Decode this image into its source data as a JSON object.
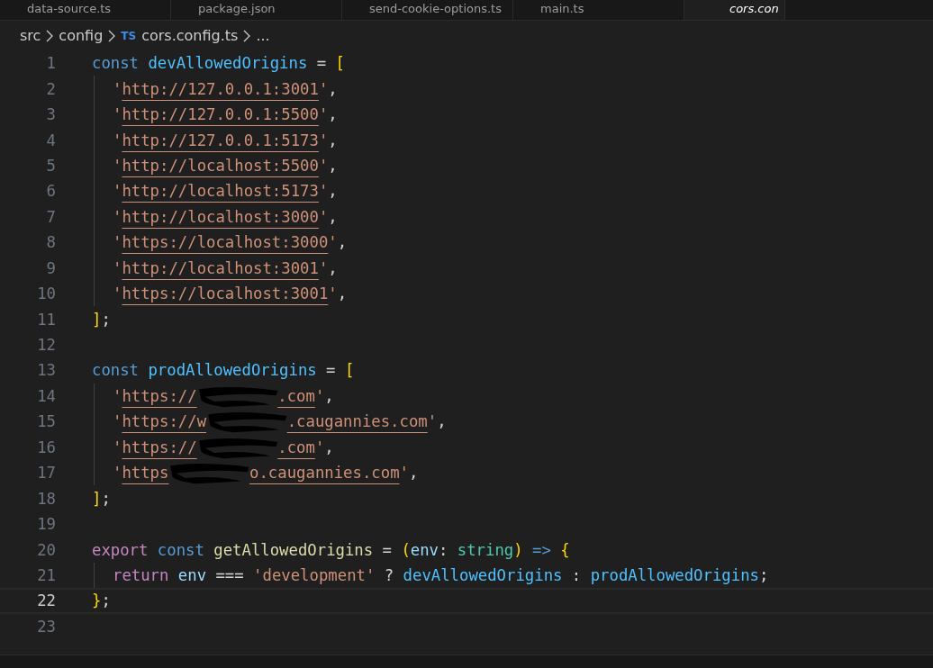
{
  "tabs": [
    {
      "label": "data-source.ts",
      "selected": false
    },
    {
      "label": "package.json",
      "selected": false
    },
    {
      "label": "send-cookie-options.ts",
      "selected": false
    },
    {
      "label": "main.ts",
      "selected": false
    },
    {
      "label": "cors.con",
      "selected": true
    }
  ],
  "breadcrumb": [
    {
      "kind": "folder",
      "label": "src"
    },
    {
      "kind": "folder",
      "label": "config"
    },
    {
      "kind": "file",
      "badge": "TS",
      "label": "cors.config.ts"
    },
    {
      "kind": "more",
      "label": "..."
    }
  ],
  "lines": [
    {
      "number": "1",
      "selected": false,
      "indented": false,
      "tokens": [
        {
          "kind": "kw",
          "text": "const "
        },
        {
          "kind": "var",
          "text": "devAllowedOrigins"
        },
        {
          "kind": "p",
          "text": " = "
        },
        {
          "kind": "br",
          "text": "["
        }
      ]
    },
    {
      "number": "2",
      "selected": false,
      "indented": true,
      "tokens": [
        {
          "kind": "str",
          "text": "'"
        },
        {
          "kind": "link",
          "text": "http://127.0.0.1:3001"
        },
        {
          "kind": "str",
          "text": "'"
        },
        {
          "kind": "p",
          "text": ","
        }
      ]
    },
    {
      "number": "3",
      "selected": false,
      "indented": true,
      "tokens": [
        {
          "kind": "str",
          "text": "'"
        },
        {
          "kind": "link",
          "text": "http://127.0.0.1:5500"
        },
        {
          "kind": "str",
          "text": "'"
        },
        {
          "kind": "p",
          "text": ","
        }
      ]
    },
    {
      "number": "4",
      "selected": false,
      "indented": true,
      "tokens": [
        {
          "kind": "str",
          "text": "'"
        },
        {
          "kind": "link",
          "text": "http://127.0.0.1:5173"
        },
        {
          "kind": "str",
          "text": "'"
        },
        {
          "kind": "p",
          "text": ","
        }
      ]
    },
    {
      "number": "5",
      "selected": false,
      "indented": true,
      "tokens": [
        {
          "kind": "str",
          "text": "'"
        },
        {
          "kind": "link",
          "text": "http://localhost:5500"
        },
        {
          "kind": "str",
          "text": "'"
        },
        {
          "kind": "p",
          "text": ","
        }
      ]
    },
    {
      "number": "6",
      "selected": false,
      "indented": true,
      "tokens": [
        {
          "kind": "str",
          "text": "'"
        },
        {
          "kind": "link",
          "text": "http://localhost:5173"
        },
        {
          "kind": "str",
          "text": "'"
        },
        {
          "kind": "p",
          "text": ","
        }
      ]
    },
    {
      "number": "7",
      "selected": false,
      "indented": true,
      "tokens": [
        {
          "kind": "str",
          "text": "'"
        },
        {
          "kind": "link",
          "text": "http://localhost:3000"
        },
        {
          "kind": "str",
          "text": "'"
        },
        {
          "kind": "p",
          "text": ","
        }
      ]
    },
    {
      "number": "8",
      "selected": false,
      "indented": true,
      "tokens": [
        {
          "kind": "str",
          "text": "'"
        },
        {
          "kind": "link",
          "text": "https://localhost:3000"
        },
        {
          "kind": "str",
          "text": "'"
        },
        {
          "kind": "p",
          "text": ","
        }
      ]
    },
    {
      "number": "9",
      "selected": false,
      "indented": true,
      "tokens": [
        {
          "kind": "str",
          "text": "'"
        },
        {
          "kind": "link",
          "text": "http://localhost:3001"
        },
        {
          "kind": "str",
          "text": "'"
        },
        {
          "kind": "p",
          "text": ","
        }
      ]
    },
    {
      "number": "10",
      "selected": false,
      "indented": true,
      "tokens": [
        {
          "kind": "str",
          "text": "'"
        },
        {
          "kind": "link",
          "text": "https://localhost:3001"
        },
        {
          "kind": "str",
          "text": "'"
        },
        {
          "kind": "p",
          "text": ","
        }
      ]
    },
    {
      "number": "11",
      "selected": false,
      "indented": false,
      "tokens": [
        {
          "kind": "br",
          "text": "]"
        },
        {
          "kind": "p",
          "text": ";"
        }
      ]
    },
    {
      "number": "12",
      "selected": false,
      "indented": false
    },
    {
      "number": "13",
      "selected": false,
      "indented": false,
      "tokens": [
        {
          "kind": "kw",
          "text": "const "
        },
        {
          "kind": "var",
          "text": "prodAllowedOrigins"
        },
        {
          "kind": "p",
          "text": " = "
        },
        {
          "kind": "br",
          "text": "["
        }
      ]
    },
    {
      "number": "14",
      "selected": false,
      "indented": true,
      "tokens": [
        {
          "kind": "str",
          "text": "'"
        },
        {
          "kind": "link",
          "text": "https://"
        },
        {
          "kind": "redaction"
        },
        {
          "kind": "link",
          "text": ".com"
        },
        {
          "kind": "str",
          "text": "'"
        },
        {
          "kind": "p",
          "text": ","
        }
      ]
    },
    {
      "number": "15",
      "selected": false,
      "indented": true,
      "tokens": [
        {
          "kind": "str",
          "text": "'"
        },
        {
          "kind": "link",
          "text": "https://w"
        },
        {
          "kind": "redaction"
        },
        {
          "kind": "link",
          "text": ".caugannies.com"
        },
        {
          "kind": "str",
          "text": "'"
        },
        {
          "kind": "p",
          "text": ","
        }
      ]
    },
    {
      "number": "16",
      "selected": false,
      "indented": true,
      "tokens": [
        {
          "kind": "str",
          "text": "'"
        },
        {
          "kind": "link",
          "text": "https://"
        },
        {
          "kind": "redaction"
        },
        {
          "kind": "link",
          "text": ".com"
        },
        {
          "kind": "str",
          "text": "'"
        },
        {
          "kind": "p",
          "text": ","
        }
      ]
    },
    {
      "number": "17",
      "selected": false,
      "indented": true,
      "tokens": [
        {
          "kind": "str",
          "text": "'"
        },
        {
          "kind": "link",
          "text": "https"
        },
        {
          "kind": "redaction"
        },
        {
          "kind": "link",
          "text": "o.caugannies.com"
        },
        {
          "kind": "str",
          "text": "'"
        },
        {
          "kind": "p",
          "text": ","
        }
      ]
    },
    {
      "number": "18",
      "selected": false,
      "indented": false,
      "tokens": [
        {
          "kind": "br",
          "text": "]"
        },
        {
          "kind": "p",
          "text": ";"
        }
      ]
    },
    {
      "number": "19",
      "selected": false,
      "indented": false
    },
    {
      "number": "20",
      "selected": false,
      "indented": false,
      "tokens": [
        {
          "kind": "ctrl",
          "text": "export "
        },
        {
          "kind": "kw",
          "text": "const "
        },
        {
          "kind": "fn",
          "text": "getAllowedOrigins"
        },
        {
          "kind": "p",
          "text": " = "
        },
        {
          "kind": "br",
          "text": "("
        },
        {
          "kind": "param",
          "text": "env"
        },
        {
          "kind": "p",
          "text": ": "
        },
        {
          "kind": "type",
          "text": "string"
        },
        {
          "kind": "br",
          "text": ")"
        },
        {
          "kind": "kw",
          "text": " => "
        },
        {
          "kind": "br",
          "text": "{"
        }
      ]
    },
    {
      "number": "21",
      "selected": false,
      "indented": true,
      "tokens": [
        {
          "kind": "ctrl",
          "text": "return "
        },
        {
          "kind": "param",
          "text": "env"
        },
        {
          "kind": "p",
          "text": " === "
        },
        {
          "kind": "str",
          "text": "'development'"
        },
        {
          "kind": "p",
          "text": " ? "
        },
        {
          "kind": "var",
          "text": "devAllowedOrigins"
        },
        {
          "kind": "p",
          "text": " : "
        },
        {
          "kind": "var",
          "text": "prodAllowedOrigins"
        },
        {
          "kind": "p",
          "text": ";"
        }
      ]
    },
    {
      "number": "22",
      "selected": true,
      "indented": false,
      "tokens": [
        {
          "kind": "br",
          "text": "}"
        },
        {
          "kind": "p",
          "text": ";"
        }
      ]
    },
    {
      "number": "23",
      "selected": false,
      "indented": false
    }
  ]
}
